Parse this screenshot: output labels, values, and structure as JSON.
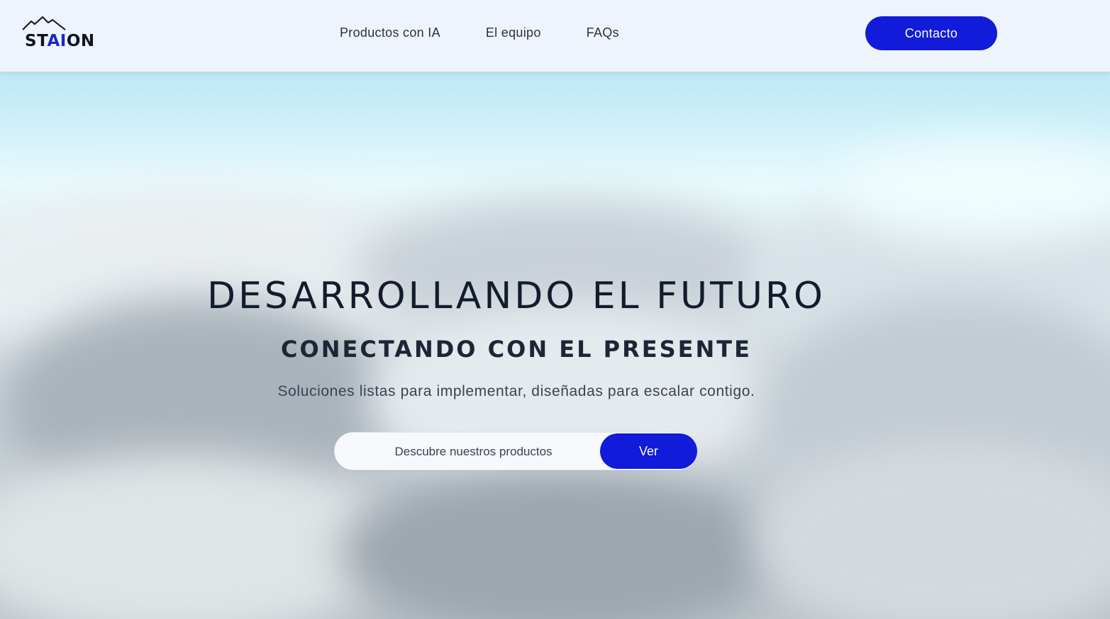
{
  "brand": {
    "logo_text_before": "ST",
    "logo_text_accent": "AI",
    "logo_text_after": "ON",
    "logo_icon": "mountain-peaks-icon"
  },
  "nav": {
    "items": [
      {
        "label": "Productos con IA"
      },
      {
        "label": "El equipo"
      },
      {
        "label": "FAQs"
      }
    ],
    "contact_label": "Contacto"
  },
  "hero": {
    "headline": "DESARROLLANDO EL FUTURO",
    "subheadline": "CONECTANDO CON EL PRESENTE",
    "tagline": "Soluciones listas para implementar, diseñadas para escalar contigo.",
    "cta": {
      "placeholder": "Descubre nuestros productos",
      "button_label": "Ver"
    }
  },
  "colors": {
    "accent": "#111bd9",
    "text_dark": "#131c2c",
    "header_bg": "#eef4fc"
  }
}
